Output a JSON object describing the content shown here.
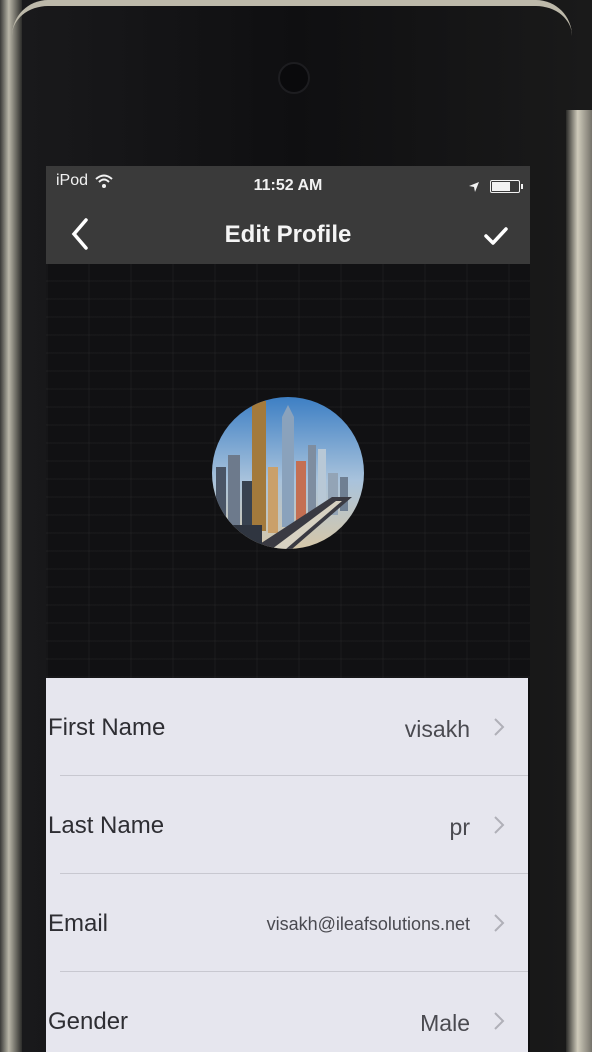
{
  "status_bar": {
    "carrier": "iPod",
    "time": "11:52 AM"
  },
  "nav": {
    "title": "Edit Profile",
    "back_icon": "chevron-left-icon",
    "done_icon": "checkmark-icon"
  },
  "profile": {
    "avatar_icon": "city-skyline-photo"
  },
  "fields": [
    {
      "label": "First Name",
      "value": "visakh"
    },
    {
      "label": "Last Name",
      "value": "pr"
    },
    {
      "label": "Email",
      "value": "visakh@ileafsolutions.net"
    },
    {
      "label": "Gender",
      "value": "Male"
    }
  ],
  "colors": {
    "nav_background": "#3a3a3a",
    "form_background": "#e6e6ee",
    "label_text": "#2e2e33"
  }
}
